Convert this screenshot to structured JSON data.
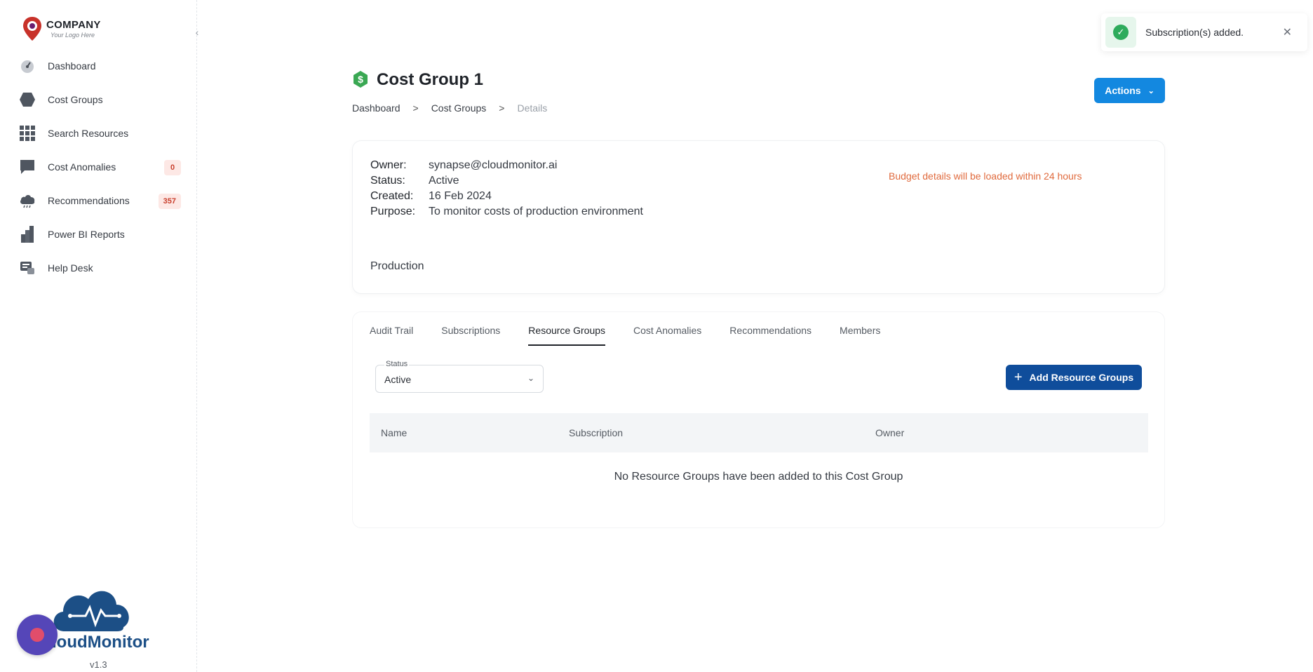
{
  "brand": {
    "company": "COMPANY",
    "tagline": "Your Logo Here",
    "product": "loudMonitor",
    "version": "v1.3"
  },
  "sidebar": {
    "items": [
      {
        "label": "Dashboard",
        "icon": "gauge-icon"
      },
      {
        "label": "Cost Groups",
        "icon": "hexagon-icon"
      },
      {
        "label": "Search Resources",
        "icon": "grid-icon"
      },
      {
        "label": "Cost Anomalies",
        "icon": "chat-icon",
        "badge": "0"
      },
      {
        "label": "Recommendations",
        "icon": "cloud-icon",
        "badge": "357"
      },
      {
        "label": "Power BI Reports",
        "icon": "bar-chart-icon"
      },
      {
        "label": "Help Desk",
        "icon": "help-desk-icon"
      }
    ]
  },
  "page": {
    "title": "Cost Group 1",
    "breadcrumb": [
      "Dashboard",
      ">",
      "Cost Groups",
      ">",
      "Details"
    ],
    "actions_label": "Actions"
  },
  "toast": {
    "message": "Subscription(s) added."
  },
  "details": {
    "owner_key": "Owner:",
    "owner": "synapse@cloudmonitor.ai",
    "status_key": "Status:",
    "status": "Active",
    "created_key": "Created:",
    "created": "16 Feb 2024",
    "purpose_key": "Purpose:",
    "purpose": "To monitor costs of production environment",
    "budget_note": "Budget details will be loaded within 24 hours",
    "tag": "Production"
  },
  "tabs": [
    "Audit Trail",
    "Subscriptions",
    "Resource Groups",
    "Cost Anomalies",
    "Recommendations",
    "Members"
  ],
  "active_tab": "Resource Groups",
  "filter": {
    "label": "Status",
    "value": "Active"
  },
  "add_button_label": "Add Resource Groups",
  "table": {
    "columns": [
      "Name",
      "Subscription",
      "Owner"
    ],
    "empty_message": "No Resource Groups have been added to this Cost Group"
  },
  "colors": {
    "primary": "#1388e0",
    "primary_dark": "#0f4d9b",
    "success": "#2eab5c",
    "warning_text": "#e06a3d",
    "badge_bg": "#fde8e5"
  }
}
